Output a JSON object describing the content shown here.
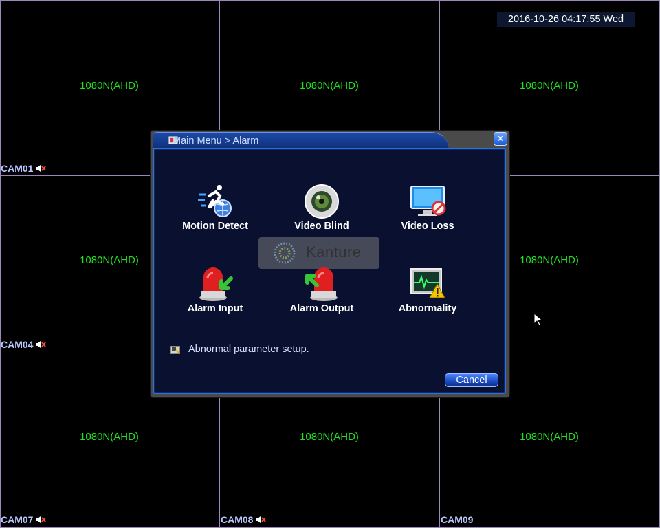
{
  "datetime": "2016-10-26 04:17:55 Wed",
  "cameras": [
    {
      "resolution": "1080N(AHD)",
      "label": ""
    },
    {
      "resolution": "1080N(AHD)",
      "label": ""
    },
    {
      "resolution": "1080N(AHD)",
      "label": ""
    },
    {
      "resolution": "1080N(AHD)",
      "label": "CAM01"
    },
    {
      "resolution": "",
      "label": ""
    },
    {
      "resolution": "1080N(AHD)",
      "label": ""
    },
    {
      "resolution": "1080N(AHD)",
      "label": "CAM04"
    },
    {
      "resolution": "1080N(AHD)",
      "label": "CAM08"
    },
    {
      "resolution": "1080N(AHD)",
      "label": "CAM09"
    }
  ],
  "cam_labels": {
    "cam01": "CAM01",
    "cam04": "CAM04",
    "cam07": "CAM07",
    "cam08": "CAM08",
    "cam09": "CAM09"
  },
  "resolution_text": "1080N(AHD)",
  "dialog": {
    "title": "Main Menu > Alarm",
    "close_label": "×",
    "items": [
      {
        "label": "Motion Detect",
        "icon": "motion-detect-icon"
      },
      {
        "label": "Video Blind",
        "icon": "video-blind-icon"
      },
      {
        "label": "Video Loss",
        "icon": "video-loss-icon"
      },
      {
        "label": "Alarm Input",
        "icon": "alarm-input-icon"
      },
      {
        "label": "Alarm Output",
        "icon": "alarm-output-icon"
      },
      {
        "label": "Abnormality",
        "icon": "abnormality-icon"
      }
    ],
    "hint": "Abnormal parameter setup.",
    "cancel_label": "Cancel",
    "watermark": "Kanture"
  },
  "colors": {
    "accent": "#1c58d4",
    "resolution_text": "#1fe31f",
    "grid_line": "#9a86b8"
  }
}
